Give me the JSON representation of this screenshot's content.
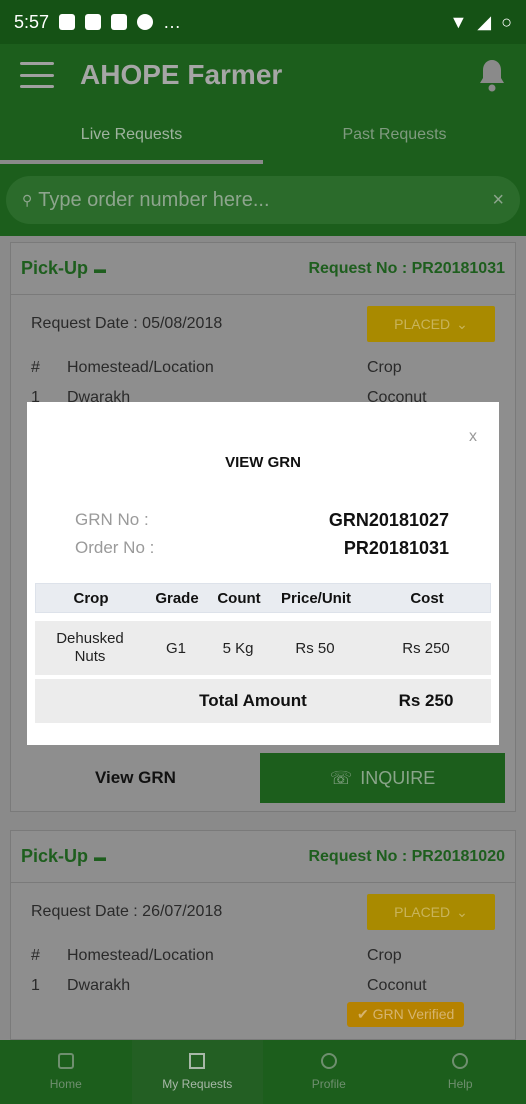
{
  "status_bar": {
    "time": "5:57",
    "overflow": "…"
  },
  "app_bar": {
    "title": "AHOPE Farmer"
  },
  "tabs": [
    {
      "label": "Live Requests",
      "active": true
    },
    {
      "label": "Past Requests",
      "active": false
    }
  ],
  "search": {
    "placeholder": "Type order number here...",
    "clear": "×"
  },
  "cards": [
    {
      "type": "Pick-Up",
      "request_no": "Request No : PR20181031",
      "request_date": "Request Date : 05/08/2018",
      "status": "PLACED",
      "table_header": {
        "index": "#",
        "location": "Homestead/Location",
        "crop": "Crop"
      },
      "row": {
        "index": "1",
        "location": "Dwarakh",
        "crop": "Coconut"
      },
      "view_grn": "View GRN",
      "inquire": "INQUIRE"
    },
    {
      "type": "Pick-Up",
      "request_no": "Request No : PR20181020",
      "request_date": "Request Date : 26/07/2018",
      "status": "PLACED",
      "table_header": {
        "index": "#",
        "location": "Homestead/Location",
        "crop": "Crop"
      },
      "row": {
        "index": "1",
        "location": "Dwarakh",
        "crop": "Coconut"
      },
      "badge": "GRN Verified"
    }
  ],
  "modal": {
    "title": "VIEW GRN",
    "close": "x",
    "grn_label": "GRN No :",
    "grn_value": "GRN20181027",
    "order_label": "Order No :",
    "order_value": "PR20181031",
    "columns": [
      "Crop",
      "Grade",
      "Count",
      "Price/Unit",
      "Cost"
    ],
    "rows": [
      {
        "crop": "Dehusked Nuts",
        "grade": "G1",
        "count": "5 Kg",
        "price": "Rs 50",
        "cost": "Rs 250"
      }
    ],
    "total_label": "Total Amount",
    "total_value": "Rs 250"
  },
  "bottom_nav": [
    {
      "label": "Home",
      "active": false
    },
    {
      "label": "My Requests",
      "active": true
    },
    {
      "label": "Profile",
      "active": false
    },
    {
      "label": "Help",
      "active": false
    }
  ],
  "colors": {
    "primary": "#1c5e1c",
    "accent": "#a98a00",
    "scrim": "#8a8a8a"
  }
}
